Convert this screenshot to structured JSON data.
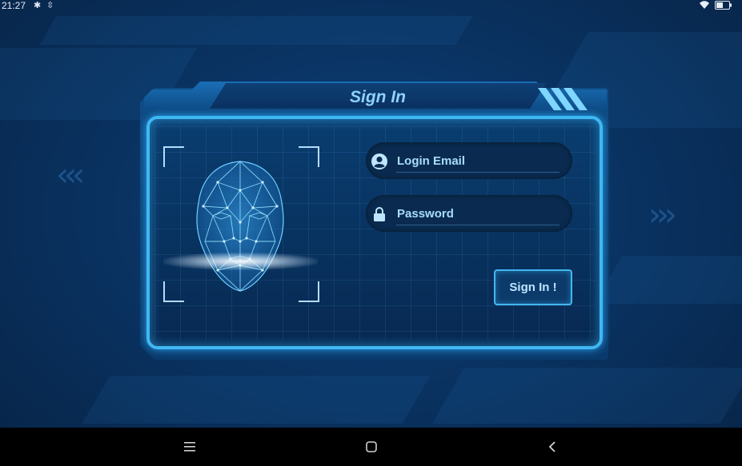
{
  "status_bar": {
    "time": "21:27",
    "icons": [
      "bluetooth-icon",
      "data-saver-icon",
      "wifi-icon",
      "battery-icon"
    ]
  },
  "dialog": {
    "title": "Sign In",
    "email": {
      "placeholder": "Login Email",
      "icon": "user-icon"
    },
    "password": {
      "placeholder": "Password",
      "icon": "lock-icon"
    },
    "submit_label": "Sign In !"
  },
  "nav_bar": {
    "icons": [
      "menu-icon",
      "home-icon",
      "back-icon"
    ]
  },
  "colors": {
    "background": "#0a3566",
    "accent": "#3fb8f2",
    "text": "#a9dcff",
    "field_bg": "#0a2b4f"
  }
}
